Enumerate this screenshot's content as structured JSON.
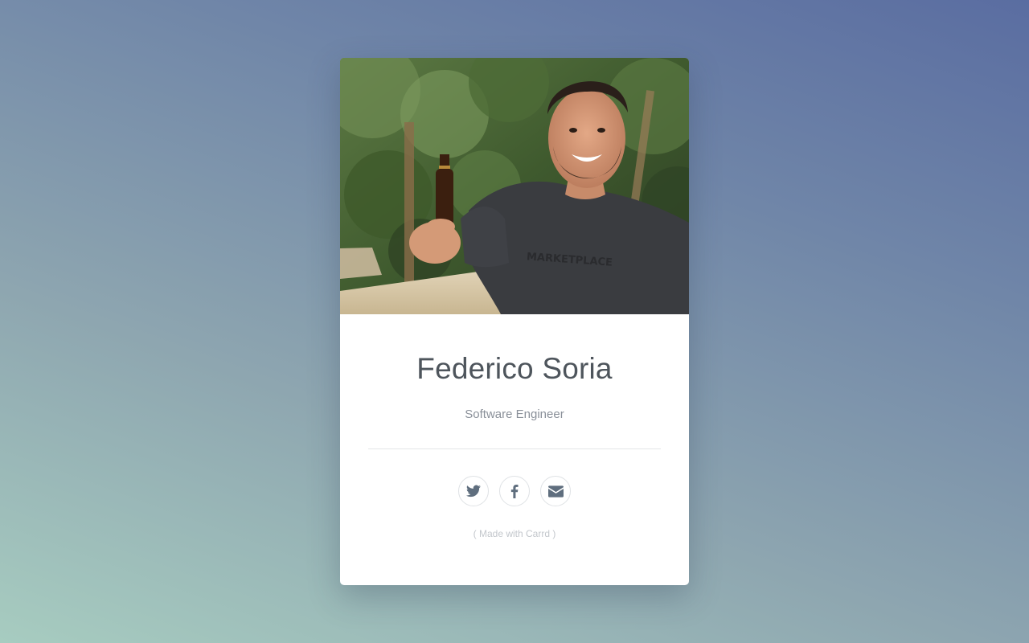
{
  "profile": {
    "name": "Federico Soria",
    "role": "Software Engineer",
    "photo_alt": "Profile photo"
  },
  "social": {
    "twitter_label": "Twitter",
    "twitter_icon": "twitter-icon",
    "facebook_label": "Facebook",
    "facebook_icon": "facebook-icon",
    "email_label": "Email",
    "email_icon": "envelope-icon",
    "icon_color": "#5f6e7e"
  },
  "footer": {
    "credit": "( Made with Carrd )"
  },
  "colors": {
    "background_start": "#a7ccc0",
    "background_end": "#5a6da1",
    "card": "#ffffff",
    "name_text": "#4e555c"
  }
}
